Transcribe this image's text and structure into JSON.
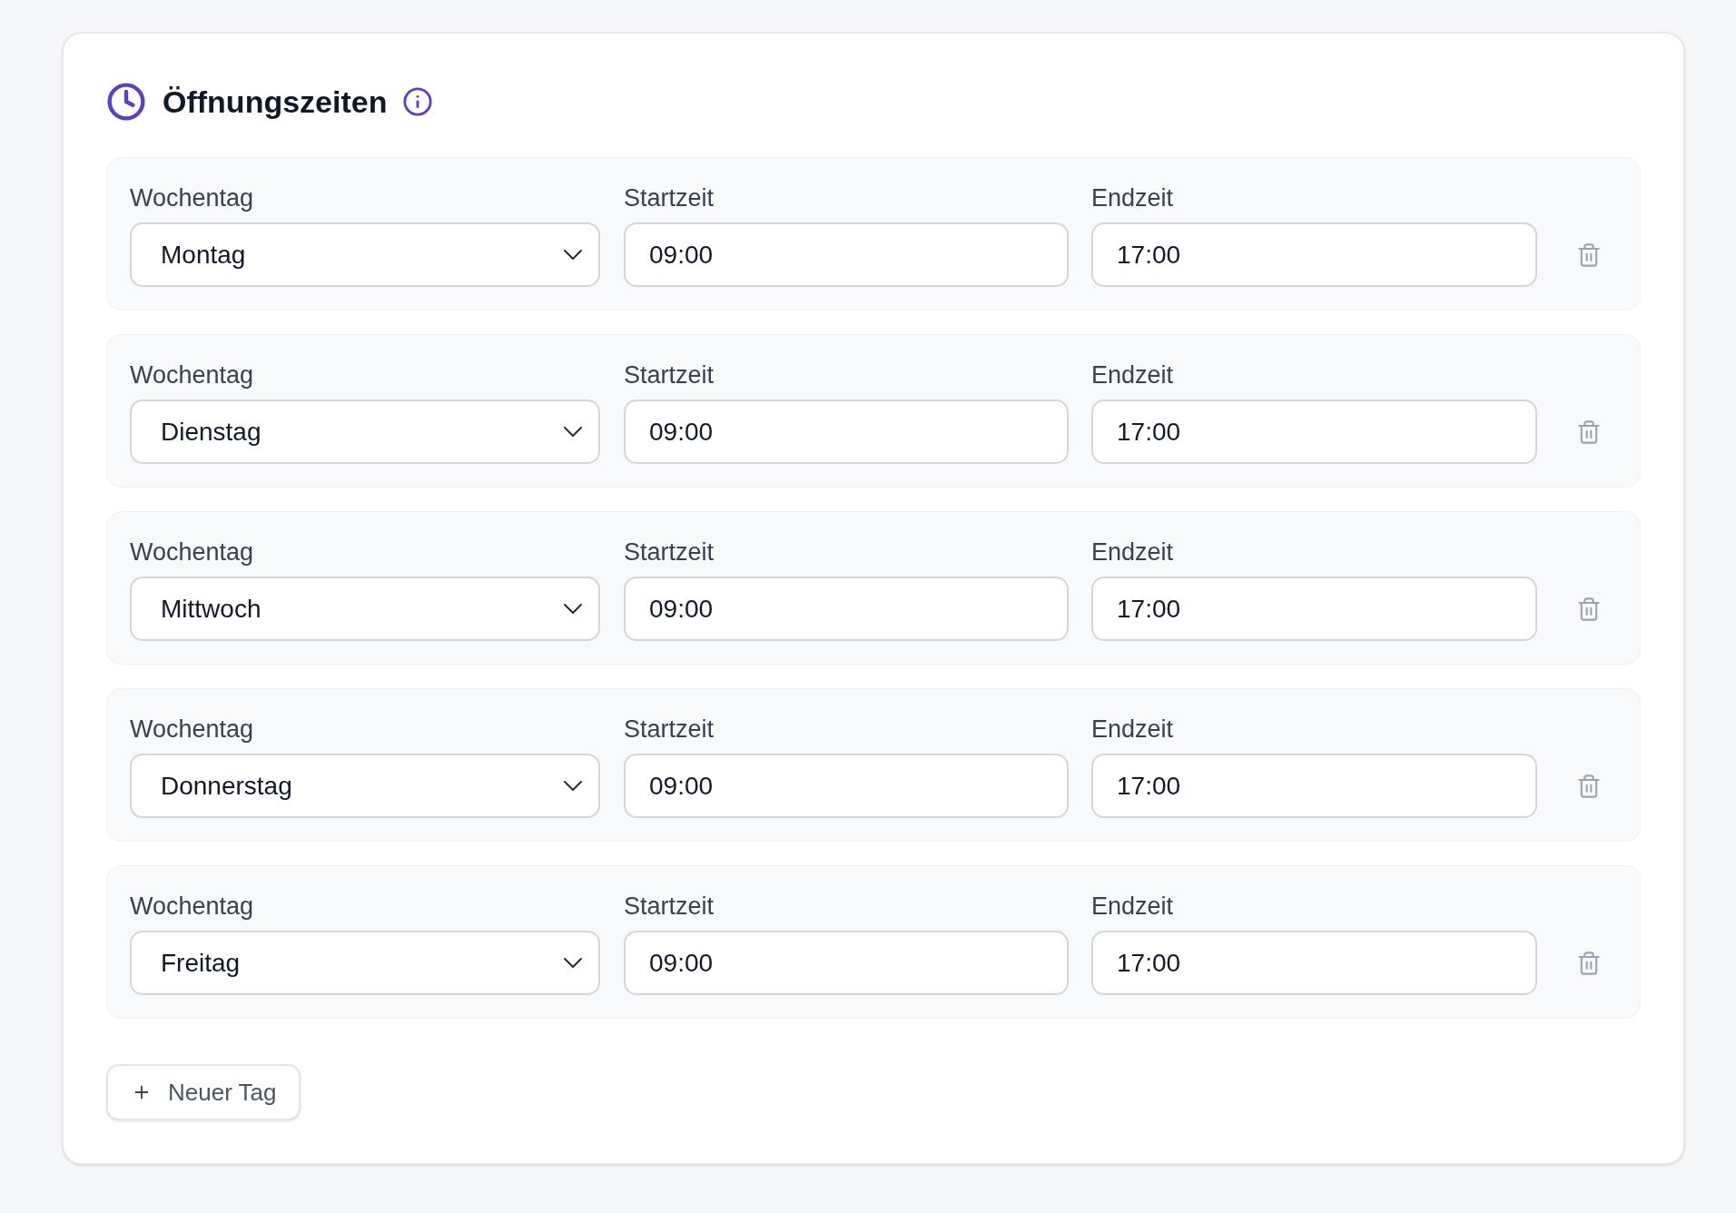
{
  "section": {
    "title": "Öffnungszeiten"
  },
  "days": [
    {
      "weekday_label": "Wochentag",
      "weekday": "Montag",
      "start_label": "Startzeit",
      "start": "09:00",
      "end_label": "Endzeit",
      "end": "17:00"
    },
    {
      "weekday_label": "Wochentag",
      "weekday": "Dienstag",
      "start_label": "Startzeit",
      "start": "09:00",
      "end_label": "Endzeit",
      "end": "17:00"
    },
    {
      "weekday_label": "Wochentag",
      "weekday": "Mittwoch",
      "start_label": "Startzeit",
      "start": "09:00",
      "end_label": "Endzeit",
      "end": "17:00"
    },
    {
      "weekday_label": "Wochentag",
      "weekday": "Donnerstag",
      "start_label": "Startzeit",
      "start": "09:00",
      "end_label": "Endzeit",
      "end": "17:00"
    },
    {
      "weekday_label": "Wochentag",
      "weekday": "Freitag",
      "start_label": "Startzeit",
      "start": "09:00",
      "end_label": "Endzeit",
      "end": "17:00"
    }
  ],
  "add_button": {
    "label": "Neuer Tag"
  }
}
